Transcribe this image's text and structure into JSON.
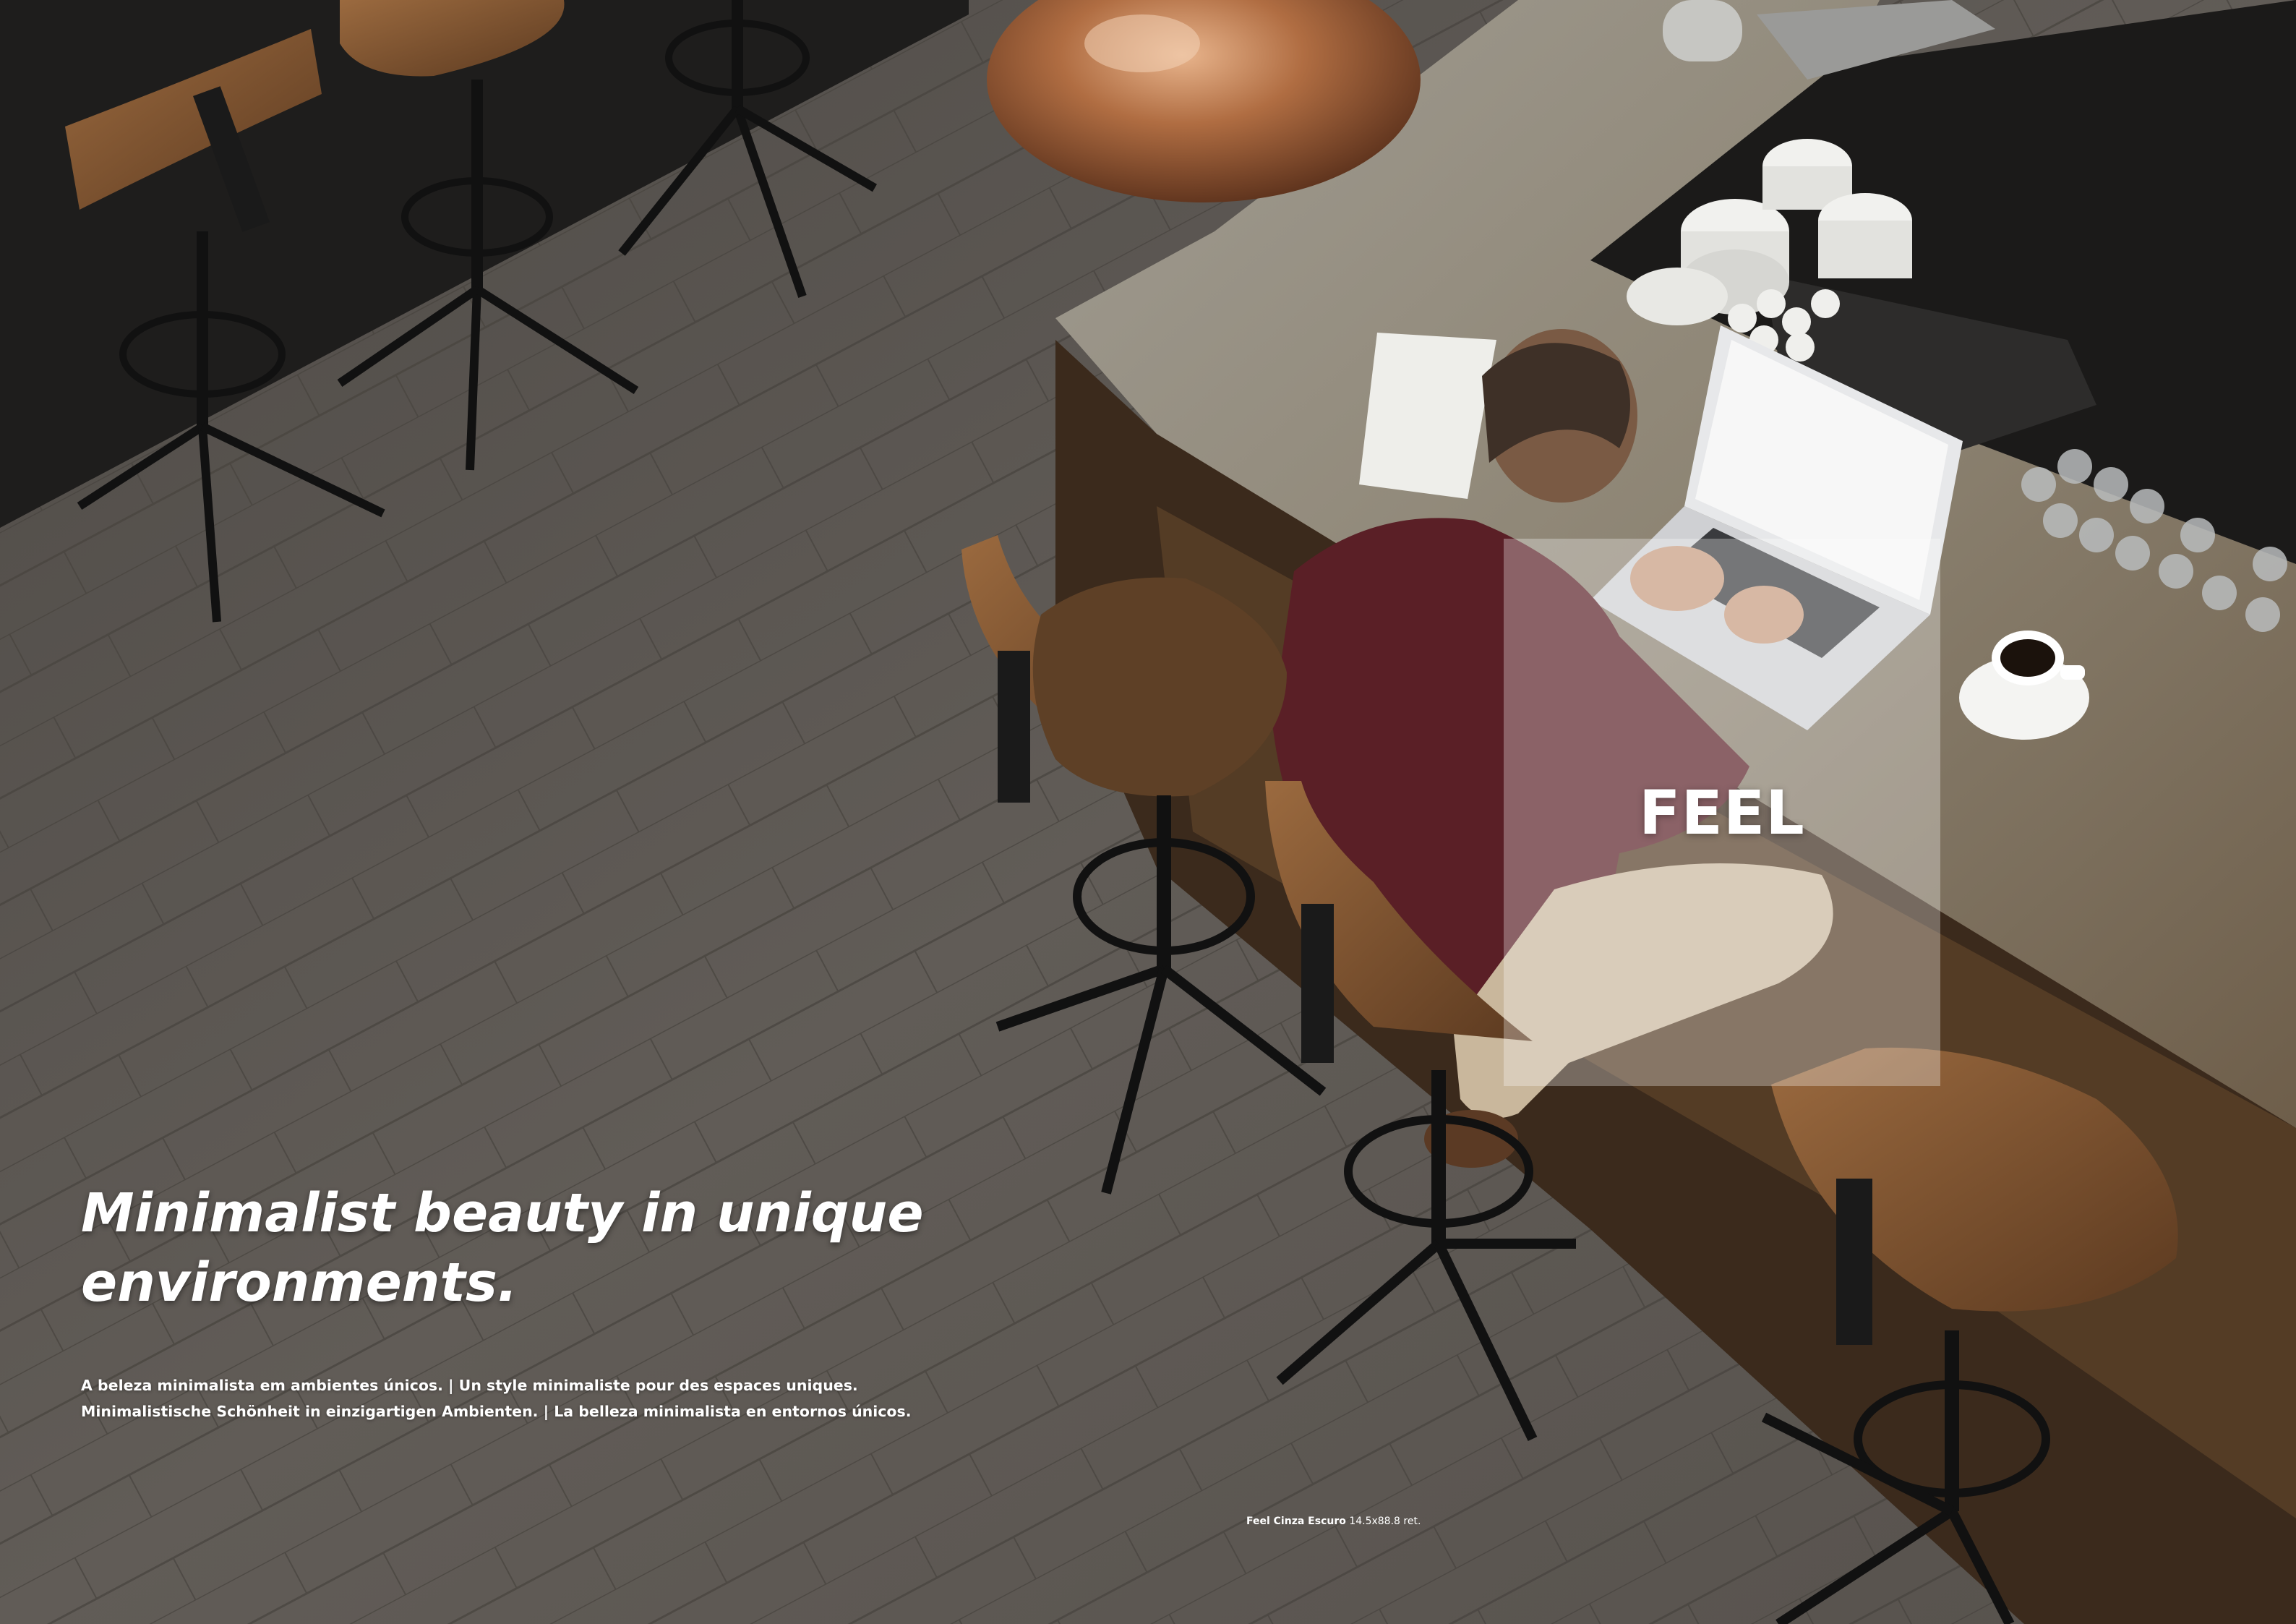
{
  "headline": {
    "line1": "Minimalist beauty in unique",
    "line2": "environments."
  },
  "subtitle": {
    "line1": "A beleza minimalista em ambientes únicos. | Un style minimaliste pour des espaces uniques.",
    "line2": "Minimalistische Schönheit in einzigartigen Ambienten. | La belleza minimalista en entornos únicos."
  },
  "brand": {
    "title": "FEEL"
  },
  "caption": {
    "product": "Feel Cinza Escuro",
    "size": "14.5x88.8 ret."
  },
  "colors": {
    "floor": "#5d5853",
    "counter_top": "#8a8476",
    "shirt": "#5a1f26",
    "copper_lamp": "#a8643a",
    "wood_seat": "#8a5a35",
    "text": "#ffffff"
  }
}
